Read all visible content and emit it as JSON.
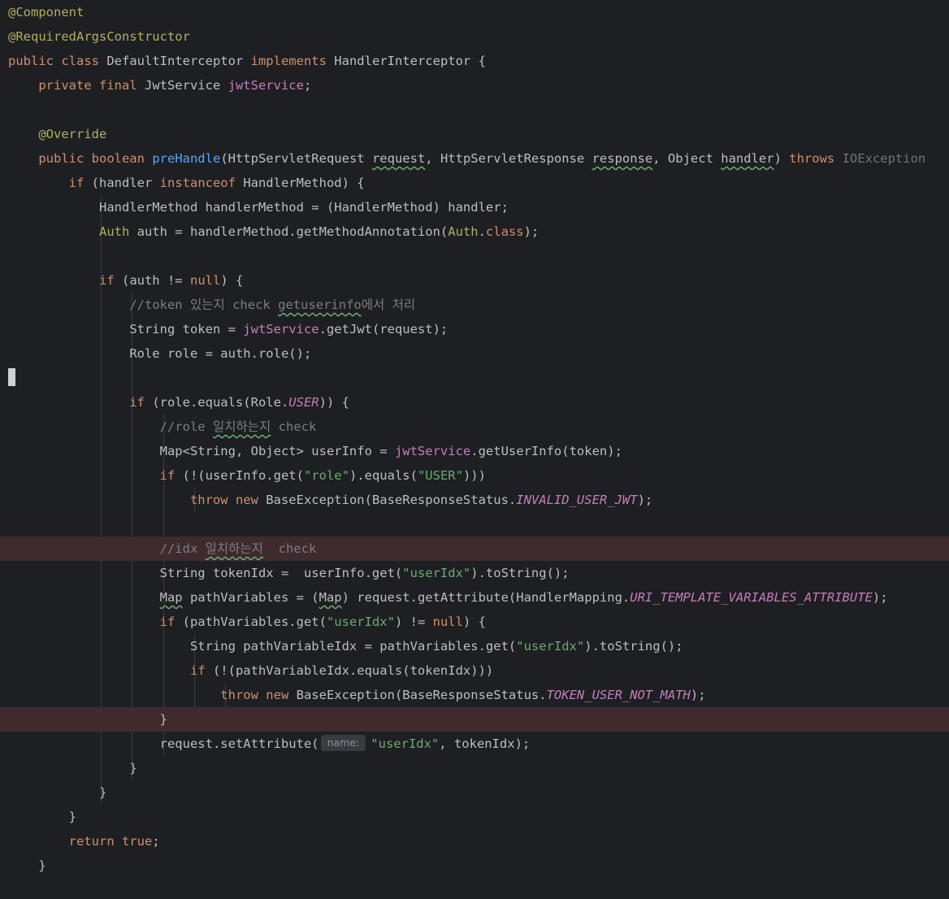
{
  "editor": {
    "lines": [
      {
        "indent": 0,
        "highlight": false,
        "tokens": [
          {
            "t": "@Component",
            "c": "ann"
          }
        ]
      },
      {
        "indent": 0,
        "highlight": false,
        "tokens": [
          {
            "t": "@RequiredArgsConstructor",
            "c": "ann"
          }
        ]
      },
      {
        "indent": 0,
        "highlight": false,
        "tokens": [
          {
            "t": "public class ",
            "c": "kw"
          },
          {
            "t": "DefaultInterceptor "
          },
          {
            "t": "implements ",
            "c": "kw"
          },
          {
            "t": "HandlerInterceptor {"
          }
        ]
      },
      {
        "indent": 1,
        "highlight": false,
        "tokens": [
          {
            "t": "private final ",
            "c": "kw"
          },
          {
            "t": "JwtService "
          },
          {
            "t": "jwtService",
            "c": "fld"
          },
          {
            "t": ";"
          }
        ]
      },
      {
        "indent": 0,
        "highlight": false,
        "tokens": []
      },
      {
        "indent": 1,
        "highlight": false,
        "tokens": [
          {
            "t": "@Override",
            "c": "ann"
          }
        ]
      },
      {
        "indent": 1,
        "highlight": false,
        "tokens": [
          {
            "t": "public boolean ",
            "c": "kw"
          },
          {
            "t": "preHandle",
            "c": "fn"
          },
          {
            "t": "(HttpServletRequest "
          },
          {
            "t": "request",
            "c": "warn"
          },
          {
            "t": ", HttpServletResponse "
          },
          {
            "t": "response",
            "c": "warn"
          },
          {
            "t": ", Object "
          },
          {
            "t": "handler",
            "c": "warn"
          },
          {
            "t": ") "
          },
          {
            "t": "throws ",
            "c": "kw"
          },
          {
            "t": "IOException",
            "c": "dim"
          }
        ]
      },
      {
        "indent": 2,
        "highlight": false,
        "tokens": [
          {
            "t": "if ",
            "c": "kw"
          },
          {
            "t": "(handler "
          },
          {
            "t": "instanceof ",
            "c": "kw"
          },
          {
            "t": "HandlerMethod) {"
          }
        ]
      },
      {
        "indent": 3,
        "highlight": false,
        "tokens": [
          {
            "t": "HandlerMethod handlerMethod = (HandlerMethod) handler;"
          }
        ]
      },
      {
        "indent": 3,
        "highlight": false,
        "tokens": [
          {
            "t": "Auth",
            "c": "ann"
          },
          {
            "t": " auth = handlerMethod.getMethodAnnotation("
          },
          {
            "t": "Auth",
            "c": "ann"
          },
          {
            "t": "."
          },
          {
            "t": "class",
            "c": "kw"
          },
          {
            "t": ");"
          }
        ]
      },
      {
        "indent": 0,
        "highlight": false,
        "tokens": []
      },
      {
        "indent": 3,
        "highlight": false,
        "tokens": [
          {
            "t": "if ",
            "c": "kw"
          },
          {
            "t": "(auth != "
          },
          {
            "t": "null",
            "c": "kw"
          },
          {
            "t": ") {"
          }
        ]
      },
      {
        "indent": 4,
        "highlight": false,
        "tokens": [
          {
            "t": "//token 있는지 check ",
            "c": "cmt"
          },
          {
            "t": "getuserinfo",
            "c": "cmt warn"
          },
          {
            "t": "에서 처리",
            "c": "cmt"
          }
        ]
      },
      {
        "indent": 4,
        "highlight": false,
        "tokens": [
          {
            "t": "String token = "
          },
          {
            "t": "jwtService",
            "c": "fld"
          },
          {
            "t": ".getJwt(request);"
          }
        ]
      },
      {
        "indent": 4,
        "highlight": false,
        "tokens": [
          {
            "t": "Role role = auth.role();"
          }
        ]
      },
      {
        "indent": 0,
        "highlight": false,
        "tokens": []
      },
      {
        "indent": 4,
        "highlight": false,
        "tokens": [
          {
            "t": "if ",
            "c": "kw"
          },
          {
            "t": "(role.equals(Role."
          },
          {
            "t": "USER",
            "c": "cst"
          },
          {
            "t": ")) {"
          }
        ]
      },
      {
        "indent": 5,
        "highlight": false,
        "tokens": [
          {
            "t": "//role ",
            "c": "cmt"
          },
          {
            "t": "일치하는지",
            "c": "cmt warn"
          },
          {
            "t": " check",
            "c": "cmt"
          }
        ]
      },
      {
        "indent": 5,
        "highlight": false,
        "tokens": [
          {
            "t": "Map<String, Object> userInfo = "
          },
          {
            "t": "jwtService",
            "c": "fld"
          },
          {
            "t": ".getUserInfo(token);"
          }
        ]
      },
      {
        "indent": 5,
        "highlight": false,
        "tokens": [
          {
            "t": "if ",
            "c": "kw"
          },
          {
            "t": "(!(userInfo.get("
          },
          {
            "t": "\"role\"",
            "c": "str"
          },
          {
            "t": ").equals("
          },
          {
            "t": "\"USER\"",
            "c": "str"
          },
          {
            "t": ")))"
          }
        ]
      },
      {
        "indent": 6,
        "highlight": false,
        "tokens": [
          {
            "t": "throw new ",
            "c": "kw"
          },
          {
            "t": "BaseException(BaseResponseStatus."
          },
          {
            "t": "INVALID_USER_JWT",
            "c": "cst"
          },
          {
            "t": ");"
          }
        ]
      },
      {
        "indent": 0,
        "highlight": false,
        "tokens": []
      },
      {
        "indent": 5,
        "highlight": true,
        "tokens": [
          {
            "t": "//idx ",
            "c": "cmt"
          },
          {
            "t": "일치하는지",
            "c": "cmt warn"
          },
          {
            "t": "  check",
            "c": "cmt"
          }
        ]
      },
      {
        "indent": 5,
        "highlight": false,
        "tokens": [
          {
            "t": "String tokenIdx =  userInfo.get("
          },
          {
            "t": "\"userIdx\"",
            "c": "str"
          },
          {
            "t": ").toString();"
          }
        ]
      },
      {
        "indent": 5,
        "highlight": false,
        "tokens": [
          {
            "t": "Map",
            "c": "warn"
          },
          {
            "t": " pathVariables = ("
          },
          {
            "t": "Map",
            "c": "warn"
          },
          {
            "t": ") request.getAttribute(HandlerMapping."
          },
          {
            "t": "URI_TEMPLATE_VARIABLES_ATTRIBUTE",
            "c": "cst"
          },
          {
            "t": ");"
          }
        ]
      },
      {
        "indent": 5,
        "highlight": false,
        "tokens": [
          {
            "t": "if ",
            "c": "kw"
          },
          {
            "t": "(pathVariables.get("
          },
          {
            "t": "\"userIdx\"",
            "c": "str"
          },
          {
            "t": ") != "
          },
          {
            "t": "null",
            "c": "kw"
          },
          {
            "t": ") {"
          }
        ]
      },
      {
        "indent": 6,
        "highlight": false,
        "tokens": [
          {
            "t": "String pathVariableIdx = pathVariables.get("
          },
          {
            "t": "\"userIdx\"",
            "c": "str"
          },
          {
            "t": ").toString();"
          }
        ]
      },
      {
        "indent": 6,
        "highlight": false,
        "tokens": [
          {
            "t": "if ",
            "c": "kw"
          },
          {
            "t": "(!(pathVariableIdx.equals(tokenIdx)))"
          }
        ]
      },
      {
        "indent": 7,
        "highlight": false,
        "tokens": [
          {
            "t": "throw new ",
            "c": "kw"
          },
          {
            "t": "BaseException(BaseResponseStatus."
          },
          {
            "t": "TOKEN_USER_NOT_MATH",
            "c": "cst"
          },
          {
            "t": ");"
          }
        ]
      },
      {
        "indent": 5,
        "highlight": true,
        "tokens": [
          {
            "t": "}"
          }
        ]
      },
      {
        "indent": 5,
        "highlight": false,
        "tokens": [
          {
            "t": "request.setAttribute("
          },
          {
            "t": "name:",
            "c": "hint"
          },
          {
            "t": "\"userIdx\"",
            "c": "str"
          },
          {
            "t": ", tokenIdx);"
          }
        ]
      },
      {
        "indent": 4,
        "highlight": false,
        "tokens": [
          {
            "t": "}"
          }
        ]
      },
      {
        "indent": 3,
        "highlight": false,
        "tokens": [
          {
            "t": "}"
          }
        ]
      },
      {
        "indent": 2,
        "highlight": false,
        "tokens": [
          {
            "t": "}"
          }
        ]
      },
      {
        "indent": 2,
        "highlight": false,
        "tokens": [
          {
            "t": "return true",
            "c": "kw"
          },
          {
            "t": ";"
          }
        ]
      },
      {
        "indent": 1,
        "highlight": false,
        "tokens": [
          {
            "t": "}"
          }
        ]
      }
    ]
  }
}
